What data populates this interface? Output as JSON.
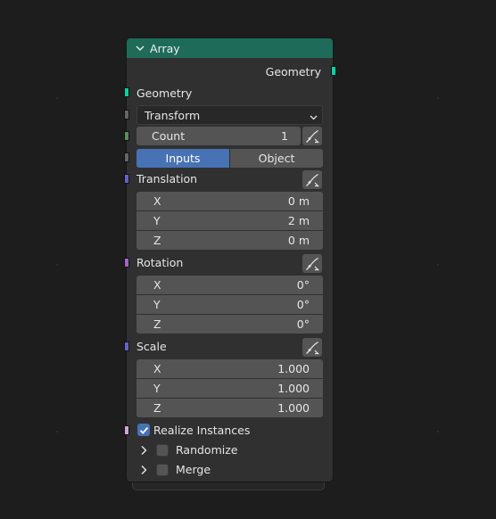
{
  "node": {
    "title": "Array",
    "header_color": "#1e6b5a",
    "outputs": {
      "geometry_label": "Geometry"
    },
    "inputs": {
      "geometry_label": "Geometry",
      "mode_value": "Transform",
      "count_label": "Count",
      "count_value": "1",
      "tabs": [
        "Inputs",
        "Object"
      ],
      "active_tab": "Inputs",
      "translation": {
        "label": "Translation",
        "x_label": "X",
        "x": "0 m",
        "y_label": "Y",
        "y": "2 m",
        "z_label": "Z",
        "z": "0 m"
      },
      "rotation": {
        "label": "Rotation",
        "x_label": "X",
        "x": "0°",
        "y_label": "Y",
        "y": "0°",
        "z_label": "Z",
        "z": "0°"
      },
      "scale": {
        "label": "Scale",
        "x_label": "X",
        "x": "1.000",
        "y_label": "Y",
        "y": "1.000",
        "z_label": "Z",
        "z": "1.000"
      },
      "realize_instances": {
        "label": "Realize Instances",
        "checked": true
      },
      "randomize": {
        "label": "Randomize",
        "checked": false
      },
      "merge": {
        "label": "Merge",
        "checked": false
      }
    },
    "socket_colors": {
      "geometry": "#00d6a3",
      "mode": "#646464",
      "count": "#598c5c",
      "tabs": "#646464",
      "vector": "#6363c7",
      "rotation": "#a363c7",
      "realize": "#cca6d6"
    },
    "icons": [
      "chevron-down-icon",
      "dropdown-arrow-icon",
      "curve-graph-icon",
      "checkmark-icon",
      "chevron-right-icon"
    ]
  }
}
